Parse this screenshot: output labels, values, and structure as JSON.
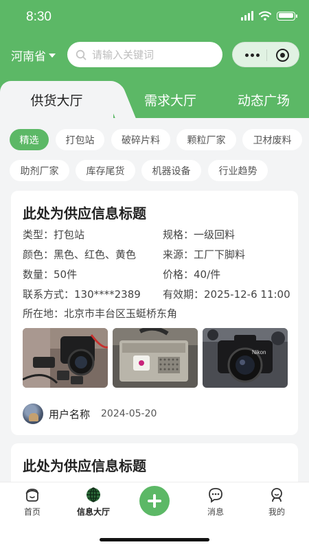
{
  "status": {
    "time": "8:30"
  },
  "header": {
    "province": "河南省",
    "search_placeholder": "请输入关键词",
    "brand_color": "#5cb866"
  },
  "tabs": [
    {
      "label": "供货大厅",
      "active": true
    },
    {
      "label": "需求大厅",
      "active": false
    },
    {
      "label": "动态广场",
      "active": false
    }
  ],
  "categories": [
    "精选",
    "打包站",
    "破碎片料",
    "颗粒厂家",
    "卫材废料",
    "助剂厂家",
    "库存尾货",
    "机器设备",
    "行业趋势"
  ],
  "selected_category": "精选",
  "posts": [
    {
      "title": "此处为供应信息标题",
      "type": "类型：打包站",
      "spec": "规格：一级回料",
      "color": "颜色：黑色、红色、黄色",
      "source": "来源：工厂下脚料",
      "quantity": "数量：50件",
      "price": "价格：40/件",
      "contact": "联系方式：130****2389",
      "validity": "有效期：2025-12-6 11:00",
      "location": "所在地：北京市丰台区玉蜓桥东角",
      "user": "用户名称",
      "date": "2024-05-20"
    },
    {
      "title": "此处为供应信息标题"
    }
  ],
  "tabbar": [
    {
      "label": "首页",
      "icon": "home-face-icon"
    },
    {
      "label": "信息大厅",
      "icon": "globe-icon",
      "active": true
    },
    {
      "label": "",
      "icon": "plus-icon"
    },
    {
      "label": "消息",
      "icon": "chat-icon"
    },
    {
      "label": "我的",
      "icon": "profile-icon"
    }
  ]
}
